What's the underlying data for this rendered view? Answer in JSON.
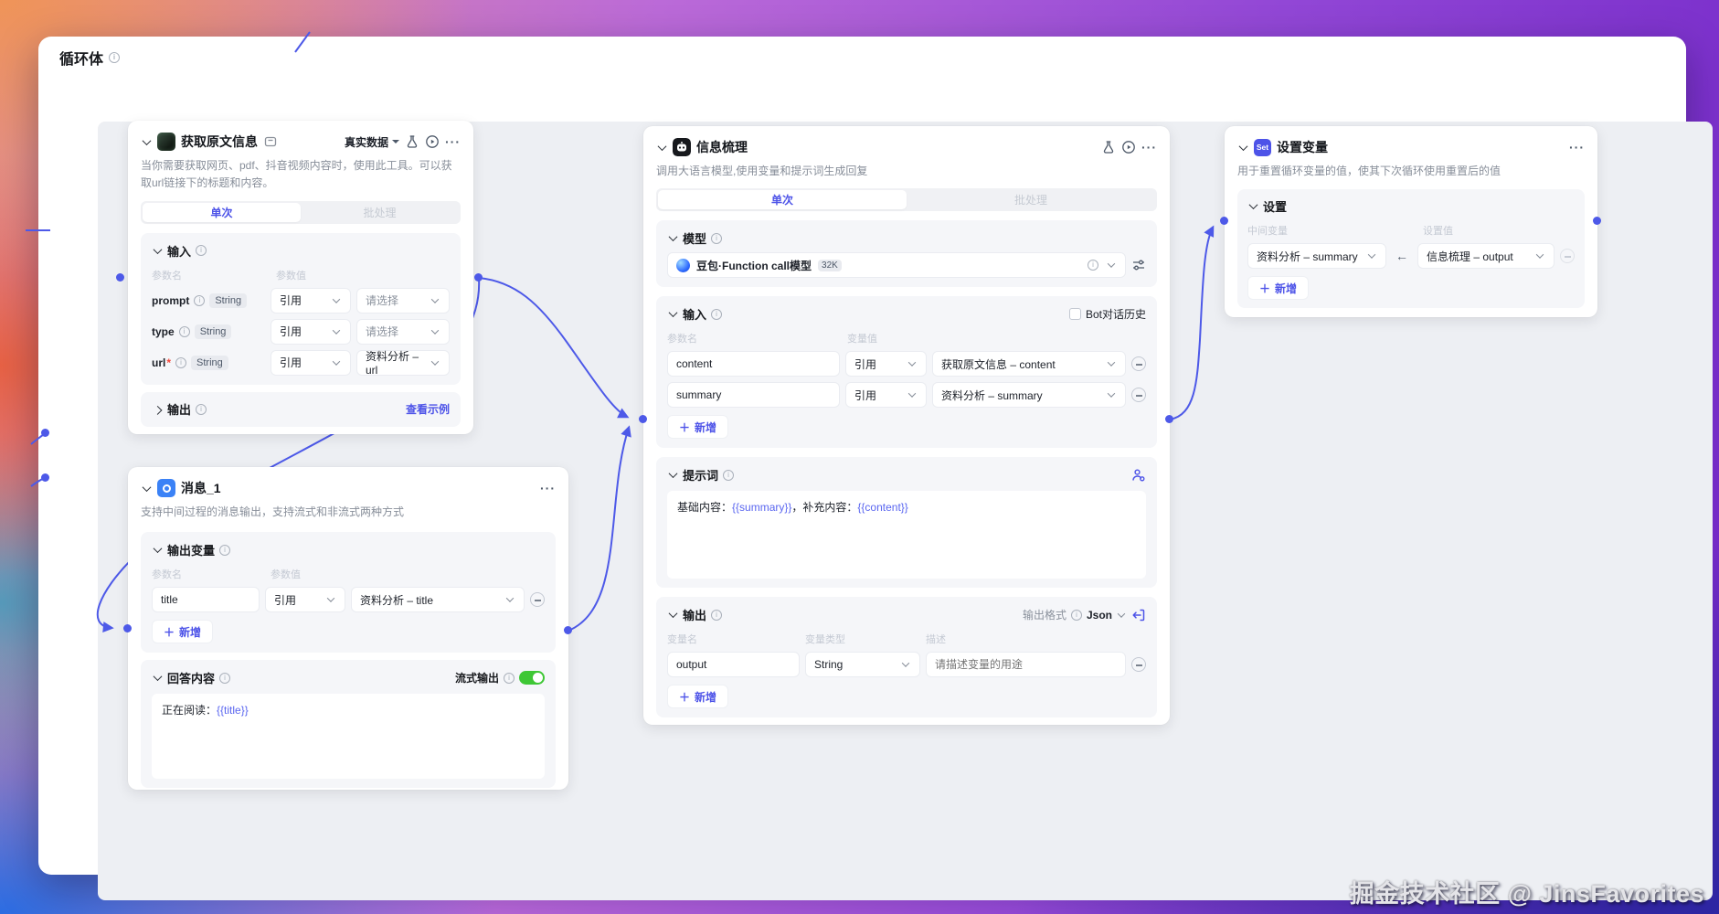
{
  "page": {
    "title": "循环体",
    "watermark": "掘金技术社区 @ JinsFavorites"
  },
  "icons": {
    "more": "···",
    "plus": "＋",
    "arrow_left": "←"
  },
  "colors": {
    "accent": "#4d53e8",
    "wire": "#4d59e8",
    "toggle_on": "#3ec735"
  },
  "nodes": {
    "get_info": {
      "title": "获取原文信息",
      "data_mode": "真实数据",
      "desc": "当你需要获取网页、pdf、抖音视频内容时，使用此工具。可以获取url链接下的标题和内容。",
      "tab_single": "单次",
      "tab_batch": "批处理",
      "input": {
        "label": "输入",
        "col_name": "参数名",
        "col_value": "参数值",
        "rows": [
          {
            "name": "prompt",
            "type": "String",
            "mode": "引用",
            "value": "请选择"
          },
          {
            "name": "type",
            "type": "String",
            "mode": "引用",
            "value": "请选择"
          },
          {
            "name": "url",
            "required": "*",
            "type": "String",
            "mode": "引用",
            "value": "资料分析 – url"
          }
        ]
      },
      "output": {
        "label": "输出",
        "example_link": "查看示例"
      }
    },
    "message": {
      "title": "消息_1",
      "desc": "支持中间过程的消息输出，支持流式和非流式两种方式",
      "output_vars": {
        "label": "输出变量",
        "col_name": "参数名",
        "col_value": "参数值",
        "rows": [
          {
            "name": "title",
            "mode": "引用",
            "value": "资料分析 – title"
          }
        ],
        "add": "新增"
      },
      "answer": {
        "label": "回答内容",
        "stream_label": "流式输出",
        "text_prefix": "正在阅读：",
        "text_var": "{{title}}"
      }
    },
    "llm": {
      "title": "信息梳理",
      "desc": "调用大语言模型,使用变量和提示词生成回复",
      "tab_single": "单次",
      "tab_batch": "批处理",
      "model": {
        "label": "模型",
        "name": "豆包·Function call模型",
        "context": "32K"
      },
      "input": {
        "label": "输入",
        "history_label": "Bot对话历史",
        "col_name": "参数名",
        "col_value": "变量值",
        "rows": [
          {
            "name": "content",
            "mode": "引用",
            "value": "获取原文信息 – content"
          },
          {
            "name": "summary",
            "mode": "引用",
            "value": "资料分析 – summary"
          }
        ],
        "add": "新增"
      },
      "prompt": {
        "label": "提示词",
        "part1": "基础内容：",
        "var1": "{{summary}}",
        "part2": "，补充内容：",
        "var2": "{{content}}"
      },
      "output": {
        "label": "输出",
        "format_label": "输出格式",
        "format": "Json",
        "col_var": "变量名",
        "col_type": "变量类型",
        "col_desc": "描述",
        "rows": [
          {
            "name": "output",
            "type": "String",
            "desc_placeholder": "请描述变量的用途"
          }
        ],
        "add": "新增"
      }
    },
    "set_var": {
      "title": "设置变量",
      "badge": "Set",
      "desc": "用于重置循环变量的值，使其下次循环使用重置后的值",
      "settings": {
        "label": "设置",
        "col_left": "中间变量",
        "col_right": "设置值",
        "rows": [
          {
            "left": "资料分析 – summary",
            "right": "信息梳理 – output"
          }
        ],
        "add": "新增"
      }
    }
  }
}
